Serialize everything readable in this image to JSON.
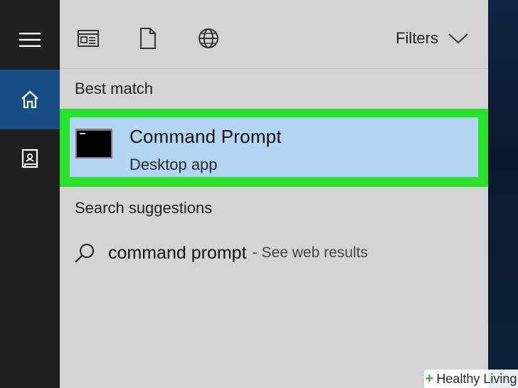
{
  "rail": {
    "items": [
      {
        "icon": "hamburger-menu-icon"
      },
      {
        "icon": "home-icon",
        "active": true
      },
      {
        "icon": "notebook-icon"
      }
    ],
    "active_color": "#174d85"
  },
  "toolbar": {
    "icons": [
      "apps-icon",
      "documents-icon",
      "web-icon"
    ],
    "filters_label": "Filters"
  },
  "best_match": {
    "heading": "Best match",
    "title": "Command Prompt",
    "subtitle": "Desktop app",
    "highlight_color": "#29e229",
    "selected_color": "#b1d5f2"
  },
  "suggestions": {
    "heading": "Search suggestions",
    "items": [
      {
        "query": "command prompt",
        "separator": "-",
        "extra": "See web results"
      }
    ]
  },
  "watermark": {
    "text": "Healthy Living",
    "plus": "+"
  }
}
